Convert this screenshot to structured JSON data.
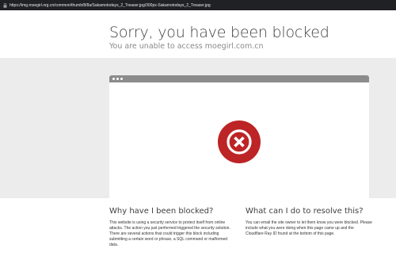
{
  "browser": {
    "url": "https://img.moegirl.org.cn/common/thumb/8/8a/Sakamotodays_2_Treaser.jpg/300px-Sakamotodays_2_Treaser.jpg"
  },
  "page": {
    "title": "Sorry, you have been blocked",
    "subtitle": "You are unable to access moegirl.com.cn"
  },
  "icons": {
    "blocked": "x-circle-icon",
    "lock": "lock-icon"
  },
  "colors": {
    "blocked_red": "#bd2426",
    "frame_grey": "#8c8c8c",
    "band_grey": "#ececec"
  },
  "why": {
    "heading": "Why have I been blocked?",
    "body": "This website is using a security service to protect itself from online attacks. The action you just performed triggered the security solution. There are several actions that could trigger this block including submitting a certain word or phrase, a SQL command or malformed data."
  },
  "resolve": {
    "heading": "What can I do to resolve this?",
    "body": "You can email the site owner to let them know you were blocked. Please include what you were doing when this page came up and the Cloudflare Ray ID found at the bottom of this page."
  }
}
